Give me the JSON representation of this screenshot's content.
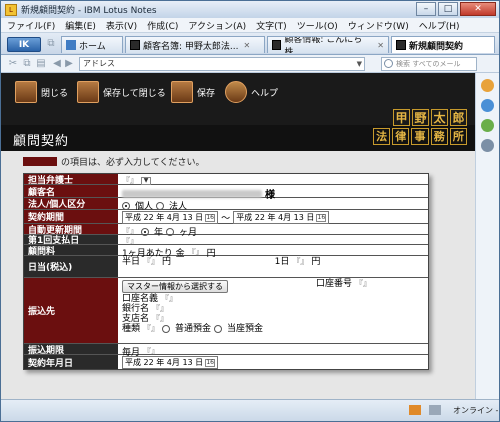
{
  "window": {
    "title": "新規顧問契約 - IBM Lotus Notes",
    "min": "–",
    "max": "□",
    "close": "✕"
  },
  "menubar": [
    "ファイル(F)",
    "編集(E)",
    "表示(V)",
    "作成(C)",
    "アクション(A)",
    "文字(T)",
    "ツール(O)",
    "ウィンドウ(W)",
    "ヘルプ(H)"
  ],
  "tabs": {
    "logo": "IK",
    "home": "ホーム",
    "tab1": "顧客名簿: 甲野太郎法...",
    "tab2": "顧客情報: こんにち株...",
    "tab3": "新規顧問契約"
  },
  "address": {
    "label": "アドレス",
    "search_placeholder": "検索 すべてのメール"
  },
  "doc_toolbar": {
    "close": "閉じる",
    "save_close": "保存して閉じる",
    "save": "保存",
    "help": "ヘルプ"
  },
  "page_title": "顧問契約",
  "firm_logo": {
    "row1": [
      "甲",
      "野",
      "太",
      "郎"
    ],
    "row2": [
      "法",
      "律",
      "事",
      "務",
      "所"
    ]
  },
  "required_note": "の項目は、必ず入力してください。",
  "form": {
    "attorney": {
      "label": "担当弁護士"
    },
    "client": {
      "label": "顧客名",
      "suffix": "様"
    },
    "entity": {
      "label": "法人/個人区分",
      "opt1": "個人",
      "opt2": "法人"
    },
    "period": {
      "label": "契約期間",
      "from": "平成 22 年 4月 13 日",
      "tilde": "～",
      "to": "平成 22 年 4月 13 日",
      "cal": "16"
    },
    "renew": {
      "label": "自動更新期間",
      "opt1": "年",
      "opt2": "ヶ月"
    },
    "first_pay": {
      "label": "第1回支払日"
    },
    "fee": {
      "label": "顧問料",
      "text1": "1ヶ月あたり 金",
      "text2": "円"
    },
    "daily": {
      "label": "日当(税込)",
      "half": "半日",
      "full": "1日",
      "yen": "円"
    },
    "transfer": {
      "label": "振込先",
      "btn": "マスター情報から選択する",
      "acct_name": "口座名義",
      "bank": "銀行名",
      "branch": "支店名",
      "type": "種類",
      "opt1": "普通預金",
      "opt2": "当座預金",
      "acct_no": "口座番号"
    },
    "deadline": {
      "label": "振込期限",
      "value": "毎月"
    },
    "contract_date": {
      "label": "契約年月日",
      "value": "平成 22 年 4月 13 日",
      "cal": "16"
    }
  },
  "status": {
    "online": "オンライン -"
  },
  "colors": {
    "required": "#6b0f0f",
    "label_bg": "#2a2a2a",
    "toolbar_bg": "#1a1a1a",
    "logo_gold": "#e4b544"
  }
}
